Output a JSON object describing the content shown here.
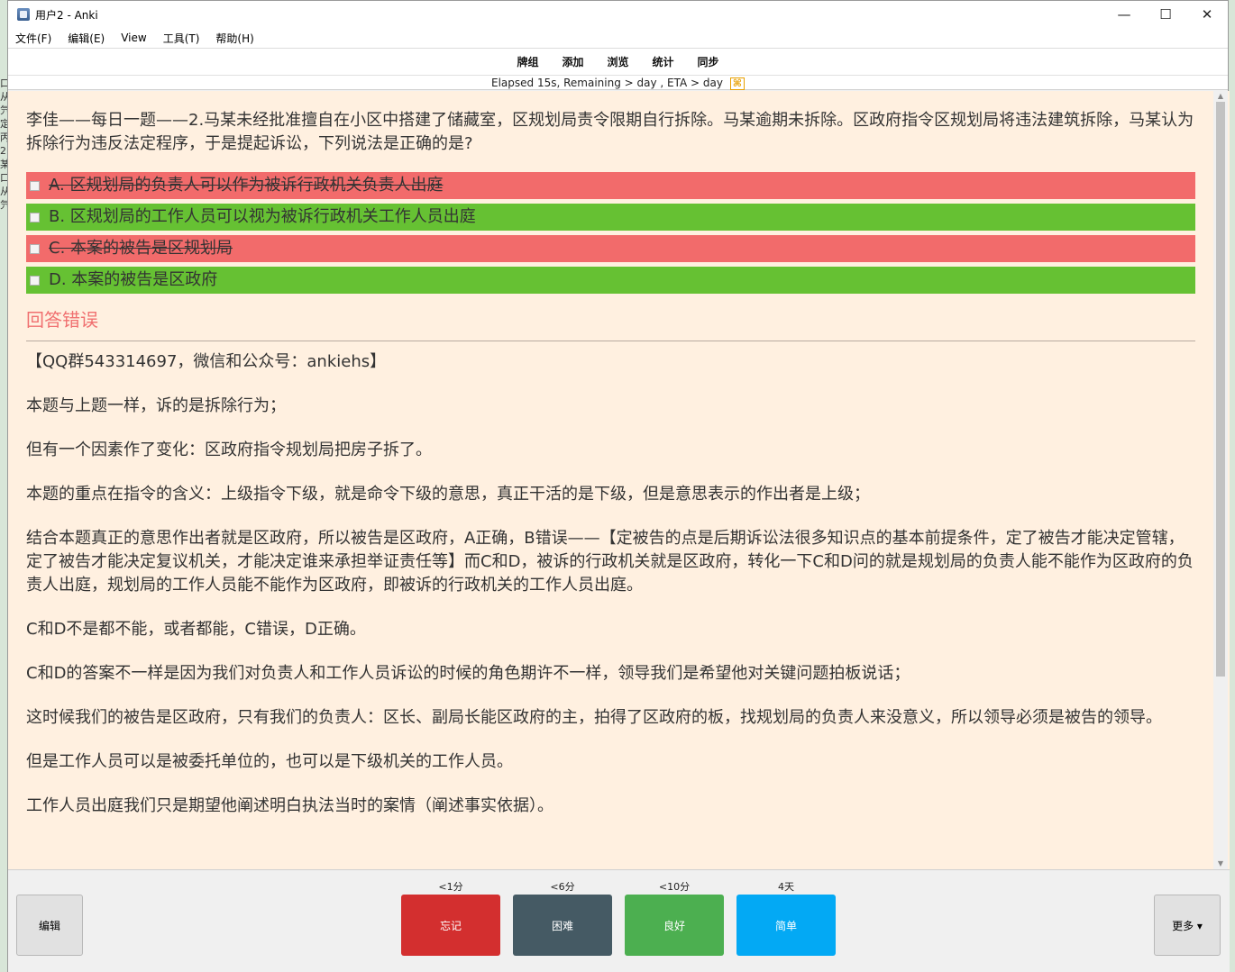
{
  "window": {
    "title": "用户2 - Anki",
    "controls": [
      "—",
      "☐",
      "✕"
    ]
  },
  "menu": [
    "文件(F)",
    "编辑(E)",
    "View",
    "工具(T)",
    "帮助(H)"
  ],
  "toolbar": [
    "牌组",
    "添加",
    "浏览",
    "统计",
    "同步"
  ],
  "status": {
    "text": "Elapsed 15s, Remaining > day , ETA > day",
    "badge": "⌘"
  },
  "card": {
    "question": "李佳——每日一题——2.马某未经批准擅自在小区中搭建了储藏室，区规划局责令限期自行拆除。马某逾期未拆除。区政府指令区规划局将违法建筑拆除，马某认为拆除行为违反法定程序，于是提起诉讼，下列说法是正确的是?",
    "options": [
      {
        "text": "A. 区规划局的负责人可以作为被诉行政机关负责人出庭",
        "state": "wrong"
      },
      {
        "text": "B. 区规划局的工作人员可以视为被诉行政机关工作人员出庭",
        "state": "right"
      },
      {
        "text": "C. 本案的被告是区规划局",
        "state": "wrong"
      },
      {
        "text": "D. 本案的被告是区政府",
        "state": "right"
      }
    ],
    "result": "回答错误",
    "explanation": [
      "【QQ群543314697，微信和公众号：ankiehs】",
      "本题与上题一样，诉的是拆除行为；",
      "但有一个因素作了变化：区政府指令规划局把房子拆了。",
      "本题的重点在指令的含义：上级指令下级，就是命令下级的意思，真正干活的是下级，但是意思表示的作出者是上级；",
      "结合本题真正的意思作出者就是区政府，所以被告是区政府，A正确，B错误——【定被告的点是后期诉讼法很多知识点的基本前提条件，定了被告才能决定管辖，定了被告才能决定复议机关，才能决定谁来承担举证责任等】而C和D，被诉的行政机关就是区政府，转化一下C和D问的就是规划局的负责人能不能作为区政府的负责人出庭，规划局的工作人员能不能作为区政府，即被诉的行政机关的工作人员出庭。",
      "C和D不是都不能，或者都能，C错误，D正确。",
      "C和D的答案不一样是因为我们对负责人和工作人员诉讼的时候的角色期许不一样，领导我们是希望他对关键问题拍板说话；",
      "这时候我们的被告是区政府，只有我们的负责人：区长、副局长能区政府的主，拍得了区政府的板，找规划局的负责人来没意义，所以领导必须是被告的领导。",
      "但是工作人员可以是被委托单位的，也可以是下级机关的工作人员。",
      "工作人员出庭我们只是期望他阐述明白执法当时的案情（阐述事实依据）。"
    ]
  },
  "bottom": {
    "edit": "编辑",
    "more": "更多 ▾",
    "ease": [
      {
        "label": "忘记",
        "interval": "<1分"
      },
      {
        "label": "困难",
        "interval": "<6分"
      },
      {
        "label": "良好",
        "interval": "<10分"
      },
      {
        "label": "简单",
        "interval": "4天"
      }
    ]
  },
  "left_strip": "口\n从\n氕\n定\n丙\n2\n某\n口\n从\n氕"
}
